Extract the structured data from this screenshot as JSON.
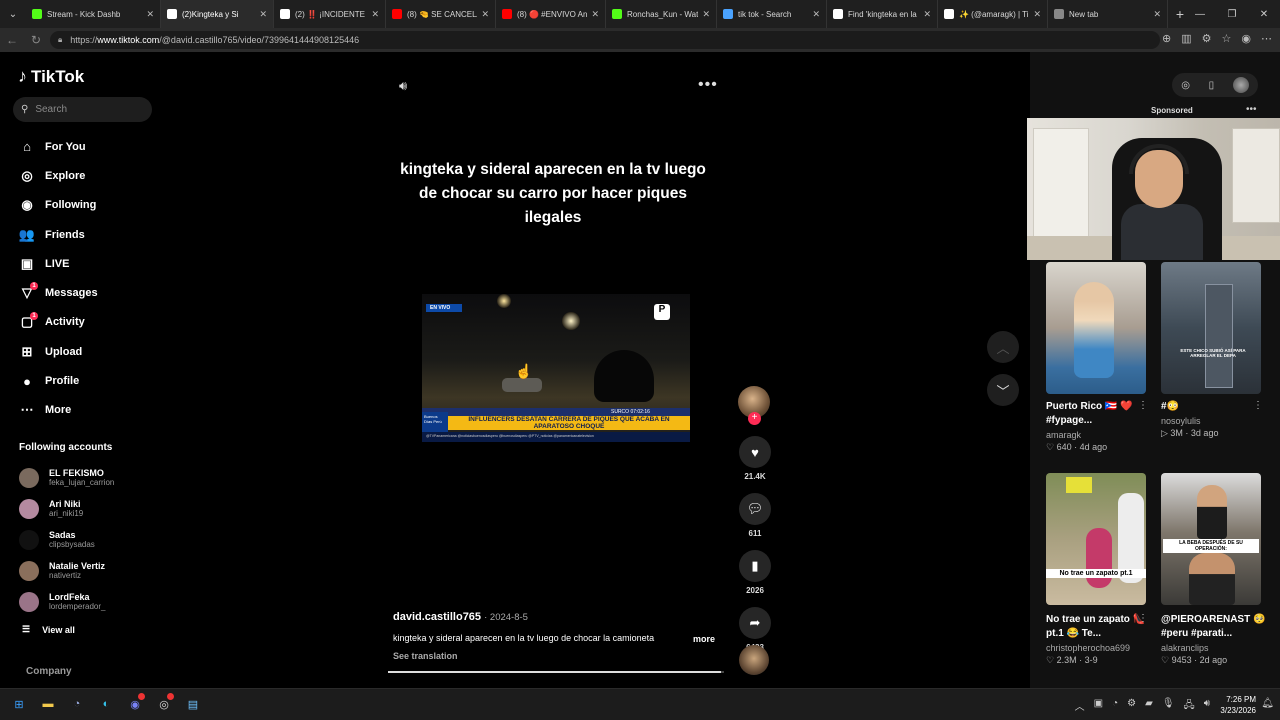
{
  "browser": {
    "tabs": [
      {
        "label": "Stream - Kick Dashb",
        "favicon": "kick-icon",
        "color": "#53fc18",
        "active": false
      },
      {
        "label": "(2)Kingteka y Si",
        "favicon": "tiktok-icon",
        "color": "#ffffff",
        "active": true
      },
      {
        "label": "(2) ‼️ ¡INCIDENTE E",
        "favicon": "tiktok-icon",
        "color": "#ffffff",
        "active": false
      },
      {
        "label": "(8) 🤏 SE CANCELA",
        "favicon": "youtube-icon",
        "color": "#ff0000",
        "active": false
      },
      {
        "label": "(8) 🔴 #ENVIVO Ant",
        "favicon": "youtube-icon",
        "color": "#ff0000",
        "active": false
      },
      {
        "label": "Ronchas_Kun - Wat",
        "favicon": "kick-icon",
        "color": "#53fc18",
        "active": false
      },
      {
        "label": "tik tok - Search",
        "favicon": "bing-icon",
        "color": "#4aa3ff",
        "active": false
      },
      {
        "label": "Find 'kingteka en la",
        "favicon": "tiktok-icon",
        "color": "#ffffff",
        "active": false
      },
      {
        "label": "✨ (@amaragk) | Ti",
        "favicon": "tiktok-icon",
        "color": "#ffffff",
        "active": false
      },
      {
        "label": "New tab",
        "favicon": "newtab-icon",
        "color": "#888888",
        "active": false
      }
    ],
    "url_prefix": "https://",
    "url_domain": "www.tiktok.com",
    "url_path": "/@david.castillo765/video/7399641444908125446"
  },
  "sidebar": {
    "logo": "TikTok",
    "search_placeholder": "Search",
    "nav": [
      {
        "label": "For You",
        "icon": "home-icon",
        "glyph": "⌂",
        "badge": ""
      },
      {
        "label": "Explore",
        "icon": "compass-icon",
        "glyph": "◎",
        "badge": ""
      },
      {
        "label": "Following",
        "icon": "following-icon",
        "glyph": "◉",
        "badge": ""
      },
      {
        "label": "Friends",
        "icon": "friends-icon",
        "glyph": "👥",
        "badge": ""
      },
      {
        "label": "LIVE",
        "icon": "live-icon",
        "glyph": "▣",
        "badge": ""
      },
      {
        "label": "Messages",
        "icon": "messages-icon",
        "glyph": "▽",
        "badge": "1"
      },
      {
        "label": "Activity",
        "icon": "activity-icon",
        "glyph": "▢",
        "badge": "1"
      },
      {
        "label": "Upload",
        "icon": "upload-icon",
        "glyph": "⊞",
        "badge": ""
      },
      {
        "label": "Profile",
        "icon": "profile-icon",
        "glyph": "●",
        "badge": ""
      },
      {
        "label": "More",
        "icon": "more-icon",
        "glyph": "⋯",
        "badge": ""
      }
    ],
    "following_header": "Following accounts",
    "accounts": [
      {
        "name": "EL FEKISMO",
        "handle": "feka_lujan_carrion",
        "color": "#7a6a5e"
      },
      {
        "name": "Ari Niki",
        "handle": "ari_niki19",
        "color": "#b48aa0"
      },
      {
        "name": "Sadas",
        "handle": "clipsbysadas",
        "color": "#111111"
      },
      {
        "name": "Natalie Vertiz",
        "handle": "nativertiz",
        "color": "#8a6f5c"
      },
      {
        "name": "LordFeka",
        "handle": "lordemperador_",
        "color": "#9a7488"
      }
    ],
    "view_all": "View all",
    "company": "Company"
  },
  "video": {
    "overlay_caption": "kingteka y sideral aparecen en la tv luego de chocar su carro por hacer piques ilegales",
    "thumb_live": "EN VIVO",
    "thumb_time": "SURCO  07:02:16",
    "thumb_banner": "INFLUENCERS DESATAN CARRERA DE PIQUES QUE ACABA EN APARATOSO CHOQUE",
    "thumb_brand": "Buenos Días Perú",
    "thumb_socials": "@TVPanamericana  @noticiasbuenosdiasperu  @buenosdiasperu  @PTV_noticias  @panamericanatelevision",
    "author": "david.castillo765",
    "date": "2024-8-5",
    "description": "kingteka y sideral aparecen en la tv luego de chocar la camioneta",
    "more": "more",
    "see_translation": "See translation",
    "progress": 0.99,
    "likes": "21.4K",
    "comments": "611",
    "saves": "2026",
    "shares": "6483"
  },
  "right_panel": {
    "sponsored": "Sponsored",
    "cards": [
      {
        "title": "Puerto Rico 🇵🇷 ❤️ #fypage...",
        "user": "amaragk",
        "stat": "♡ 640 · 4d ago"
      },
      {
        "title": "#😳",
        "user": "nosoylulis",
        "stat": "▷ 3M · 3d ago"
      },
      {
        "title": "No trae un zapato 👠 pt.1 😂 Te...",
        "user": "christopherochoa699",
        "stat": "♡ 2.3M · 3-9"
      },
      {
        "title": "@PIEROARENAST 🥺 #peru #parati...",
        "user": "alakranclips",
        "stat": "♡ 9453 · 2d ago"
      }
    ],
    "thumb3_text": "No trae un zapato pt.1",
    "thumb4_text": "LA BEBA DESPUÉS DE SU OPERACIÓN:",
    "thumb2_text": "ESTE CHICO SUBIÓ ASÍ PARA ARREGLAR EL DEPA"
  },
  "taskbar": {
    "time": "7:26 PM",
    "date": "3/23/2026"
  },
  "colors": {
    "accent": "#fe2c55",
    "background": "#000000"
  }
}
